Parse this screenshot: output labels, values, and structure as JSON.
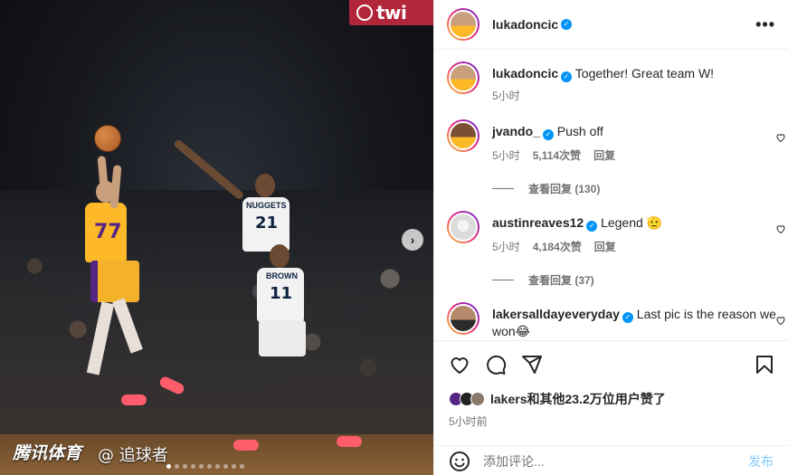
{
  "photo": {
    "banner_text": "twi",
    "lakers_number": "77",
    "nuggets_jersey": "NUGGETS",
    "nuggets_number": "21",
    "brown_name": "BROWN",
    "brown_number": "11",
    "watermark_brand": "腾讯体育",
    "watermark_handle": "@ 追球者",
    "carousel": {
      "total": 10,
      "active": 1
    }
  },
  "header": {
    "username": "lukadoncic",
    "verified": true
  },
  "caption": {
    "username": "lukadoncic",
    "text": "Together! Great team W!",
    "time": "5小时"
  },
  "comments": [
    {
      "username": "jvando_",
      "text": "Push off",
      "time": "5小时",
      "likes": "5,114次赞",
      "reply": "回复",
      "view_replies": "查看回复 (130)"
    },
    {
      "username": "austinreaves12",
      "text": "Legend 🫡",
      "time": "5小时",
      "likes": "4,184次赞",
      "reply": "回复",
      "view_replies": "查看回复 (37)"
    },
    {
      "username": "lakersalldayeveryday",
      "text": "Last pic is the reason we won😂"
    }
  ],
  "actions": {
    "likes_text": "lakers和其他23.2万位用户赞了",
    "time_ago": "5小时前",
    "comment_placeholder": "添加评论...",
    "post_label": "发布"
  },
  "colors": {
    "accent": "#0095f6",
    "lakers_gold": "#fdb927",
    "lakers_purple": "#552583"
  }
}
